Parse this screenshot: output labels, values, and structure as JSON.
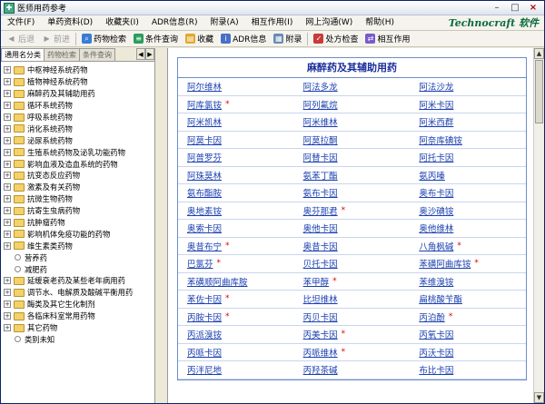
{
  "window": {
    "title": "医师用药参考"
  },
  "brand": "Technocraft 软件",
  "menu": [
    "文件(F)",
    "单药资料(D)",
    "收藏夹(I)",
    "ADR信息(R)",
    "附录(A)",
    "相互作用(I)",
    "网上沟通(W)",
    "帮助(H)"
  ],
  "toolbar": {
    "back": "后退",
    "forward": "前进",
    "drug_search": "药物检索",
    "cond_search": "条件查询",
    "favorites": "收藏",
    "adr": "ADR信息",
    "appendix": "附录",
    "rx_check": "处方检查",
    "interaction": "相互作用"
  },
  "tabs": [
    "通用名分类",
    "药物检索",
    "条件查询"
  ],
  "tree": [
    {
      "label": "中枢神经系统药物",
      "type": "folder"
    },
    {
      "label": "植物神经系统药物",
      "type": "folder"
    },
    {
      "label": "麻醉药及其辅助用药",
      "type": "folder"
    },
    {
      "label": "循环系统药物",
      "type": "folder"
    },
    {
      "label": "呼吸系统药物",
      "type": "folder"
    },
    {
      "label": "消化系统药物",
      "type": "folder"
    },
    {
      "label": "泌尿系统药物",
      "type": "folder"
    },
    {
      "label": "生殖系统药物及泌乳功能药物",
      "type": "folder"
    },
    {
      "label": "影响血液及造血系统的药物",
      "type": "folder"
    },
    {
      "label": "抗变态反应药物",
      "type": "folder"
    },
    {
      "label": "激素及有关药物",
      "type": "folder"
    },
    {
      "label": "抗微生物药物",
      "type": "folder"
    },
    {
      "label": "抗寄生虫病药物",
      "type": "folder"
    },
    {
      "label": "抗肿瘤药物",
      "type": "folder"
    },
    {
      "label": "影响机体免疫功能的药物",
      "type": "folder"
    },
    {
      "label": "维生素类药物",
      "type": "folder"
    },
    {
      "label": "营养药",
      "type": "leaf"
    },
    {
      "label": "减肥药",
      "type": "leaf"
    },
    {
      "label": "延缓衰老药及某些老年病用药",
      "type": "folder"
    },
    {
      "label": "调节水、电解质及酸碱平衡用药",
      "type": "folder"
    },
    {
      "label": "酶类及其它生化制剂",
      "type": "folder"
    },
    {
      "label": "各临床科室常用药物",
      "type": "folder"
    },
    {
      "label": "其它药物",
      "type": "folder"
    },
    {
      "label": "类别未知",
      "type": "leaf"
    }
  ],
  "content": {
    "title": "麻醉药及其辅助用药",
    "rows": [
      [
        {
          "name": "阿尔维林",
          "star": false
        },
        {
          "name": "阿法多龙",
          "star": false
        },
        {
          "name": "阿法沙龙",
          "star": false
        }
      ],
      [
        {
          "name": "阿库氯铵",
          "star": true
        },
        {
          "name": "阿列氟烷",
          "star": false
        },
        {
          "name": "阿米卡因",
          "star": false
        }
      ],
      [
        {
          "name": "阿米凯林",
          "star": false
        },
        {
          "name": "阿米维林",
          "star": false
        },
        {
          "name": "阿米西群",
          "star": false
        }
      ],
      [
        {
          "name": "阿莫卡因",
          "star": false
        },
        {
          "name": "阿莫拉酮",
          "star": false
        },
        {
          "name": "阿奈库碘铵",
          "star": false
        }
      ],
      [
        {
          "name": "阿普罗芬",
          "star": false
        },
        {
          "name": "阿替卡因",
          "star": false
        },
        {
          "name": "阿托卡因",
          "star": false
        }
      ],
      [
        {
          "name": "阿珠莫林",
          "star": false
        },
        {
          "name": "氨苯丁酯",
          "star": false
        },
        {
          "name": "氨丙嗪",
          "star": false
        }
      ],
      [
        {
          "name": "氨布酯胺",
          "star": false
        },
        {
          "name": "氨布卡因",
          "star": false
        },
        {
          "name": "奥布卡因",
          "star": false
        }
      ],
      [
        {
          "name": "奥地素铵",
          "star": false
        },
        {
          "name": "奥芬那君",
          "star": true
        },
        {
          "name": "奥沙碘铵",
          "star": false
        }
      ],
      [
        {
          "name": "奥索卡因",
          "star": false
        },
        {
          "name": "奥他卡因",
          "star": false
        },
        {
          "name": "奥他维林",
          "star": false
        }
      ],
      [
        {
          "name": "奥昔布宁",
          "star": true
        },
        {
          "name": "奥昔卡因",
          "star": false
        },
        {
          "name": "八角枫碱",
          "star": true
        }
      ],
      [
        {
          "name": "巴氯芬",
          "star": true
        },
        {
          "name": "贝托卡因",
          "star": false
        },
        {
          "name": "苯磺阿曲库铵",
          "star": true
        }
      ],
      [
        {
          "name": "苯磺顺阿曲库胺",
          "star": false
        },
        {
          "name": "苯甲醇",
          "star": true
        },
        {
          "name": "苯维溴铵",
          "star": false
        }
      ],
      [
        {
          "name": "苯佐卡因",
          "star": true
        },
        {
          "name": "比坦维林",
          "star": false
        },
        {
          "name": "扁桃酸苄酯",
          "star": false
        }
      ],
      [
        {
          "name": "丙胺卡因",
          "star": true
        },
        {
          "name": "丙贝卡因",
          "star": false
        },
        {
          "name": "丙泊酚",
          "star": true
        }
      ],
      [
        {
          "name": "丙派溴铵",
          "star": false
        },
        {
          "name": "丙美卡因",
          "star": true
        },
        {
          "name": "丙氧卡因",
          "star": false
        }
      ],
      [
        {
          "name": "丙哌卡因",
          "star": false
        },
        {
          "name": "丙哌维林",
          "star": true
        },
        {
          "name": "丙沃卡因",
          "star": false
        }
      ],
      [
        {
          "name": "丙泮尼地",
          "star": false
        },
        {
          "name": "丙羟茶碱",
          "star": false
        },
        {
          "name": "布比卡因",
          "star": false
        }
      ]
    ]
  },
  "colors": {
    "link": "#1a3fb0",
    "star": "#dd0000",
    "brand": "#0a6b3a",
    "title": "#1a2f9a"
  }
}
